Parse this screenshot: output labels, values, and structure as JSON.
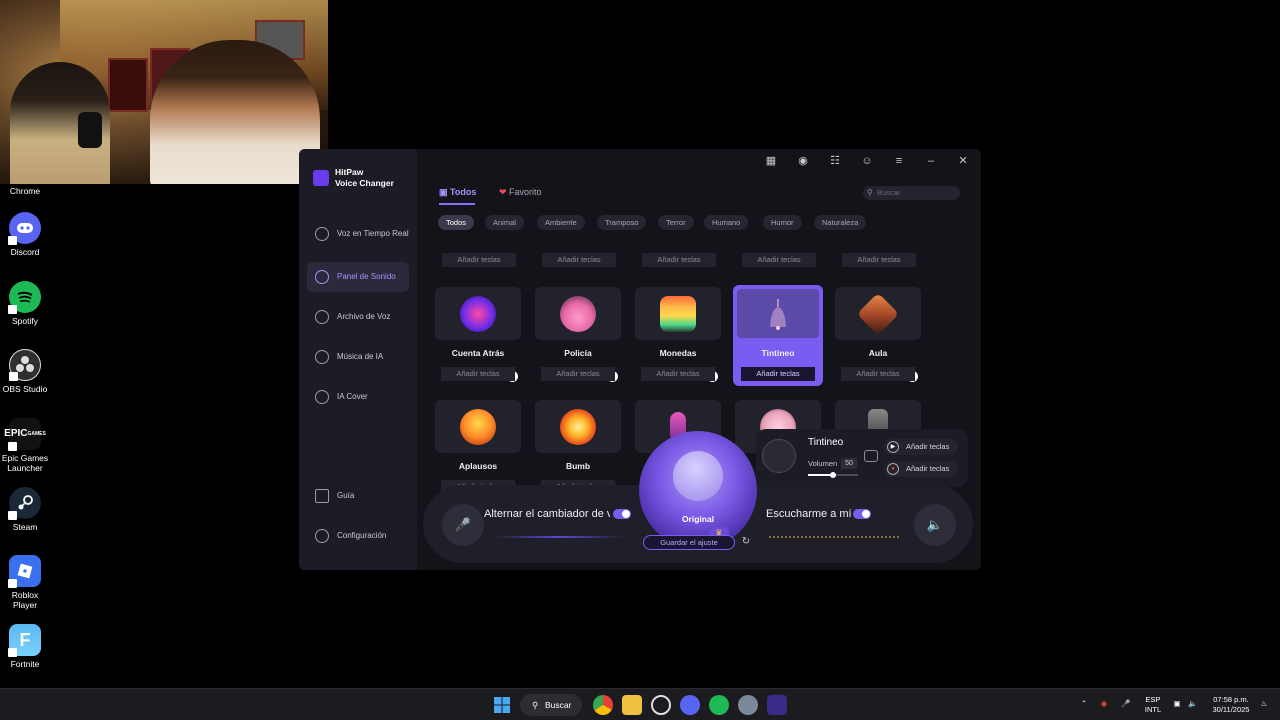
{
  "desktop": {
    "icons": [
      {
        "label": "Chrome",
        "icon": "chrome-icon"
      },
      {
        "label": "Discord",
        "icon": "discord-icon",
        "color": "#5865F2"
      },
      {
        "label": "Spotify",
        "icon": "spotify-icon",
        "color": "#1DB954"
      },
      {
        "label": "OBS Studio",
        "icon": "obs-icon",
        "color": "#302e31"
      },
      {
        "label": "Epic Games Launcher",
        "icon": "epic-games-icon",
        "color": "#111111"
      },
      {
        "label": "Steam",
        "icon": "steam-icon",
        "color": "#1b2838"
      },
      {
        "label": "Roblox Player",
        "icon": "roblox-icon",
        "color": "#3a6ff0"
      },
      {
        "label": "Fortnite",
        "icon": "fortnite-icon",
        "color": "#5ab8f0"
      }
    ]
  },
  "app": {
    "title_line1": "HitPaw",
    "title_line2": "Voice Changer",
    "accent": "#7b5cf0",
    "nav": [
      {
        "label": "Voz en Tiempo Real",
        "icon": "microphone-icon"
      },
      {
        "label": "Panel de Sonido",
        "icon": "headphones-icon",
        "active": true
      },
      {
        "label": "Archivo de Voz",
        "icon": "file-voice-icon"
      },
      {
        "label": "Música de IA",
        "icon": "music-note-icon"
      },
      {
        "label": "IA Cover",
        "icon": "ai-cover-icon"
      }
    ],
    "nav_bottom": [
      {
        "label": "Guía",
        "icon": "book-icon"
      },
      {
        "label": "Configuración",
        "icon": "gear-icon"
      }
    ],
    "topbar_icons": [
      "guide-book-icon",
      "discord-icon",
      "cart-icon",
      "user-icon",
      "menu-icon",
      "minimize-icon",
      "close-icon"
    ],
    "tabs": {
      "all": "Todos",
      "favorite": "Favorito"
    },
    "search_placeholder": "Buscar",
    "categories": [
      "Todos",
      "Animal",
      "Ambiente",
      "Tramposo",
      "Terror",
      "Humano",
      "Humor",
      "Naturaleza"
    ],
    "key_label": "Añadir teclas",
    "sounds_row1": [
      {
        "name": "Cuenta Atrás",
        "icon": "countdown-icon"
      },
      {
        "name": "Policía",
        "icon": "police-pig-icon"
      },
      {
        "name": "Monedas",
        "icon": "coins-icon"
      },
      {
        "name": "Tintineo",
        "icon": "bell-icon",
        "selected": true
      },
      {
        "name": "Aula",
        "icon": "classroom-icon"
      }
    ],
    "sounds_row2": [
      {
        "name": "Aplausos",
        "icon": "applause-icon"
      },
      {
        "name": "Bumb",
        "icon": "explosion-icon"
      }
    ],
    "now_playing": {
      "title": "Tintineo",
      "volume_label": "Volumen",
      "volume": "50",
      "volume_level": 0.5,
      "play_key": "Añadir teclas",
      "stop_key": "Añadir teclas"
    },
    "voice": {
      "preset": "Original",
      "save": "Guardar el ajuste",
      "toggle_changer": "Alternar el cambiador de vc",
      "toggle_hear": "Escucharme a mí r"
    }
  },
  "taskbar": {
    "search": "Buscar",
    "apps": [
      "windows-start-icon",
      "chrome-icon",
      "file-explorer-icon",
      "obs-icon",
      "discord-icon",
      "spotify-icon",
      "settings-icon",
      "hitpaw-icon"
    ],
    "language_line1": "ESP",
    "language_line2": "INTL",
    "time": "07:58 p.m.",
    "date": "30/11/2025"
  }
}
